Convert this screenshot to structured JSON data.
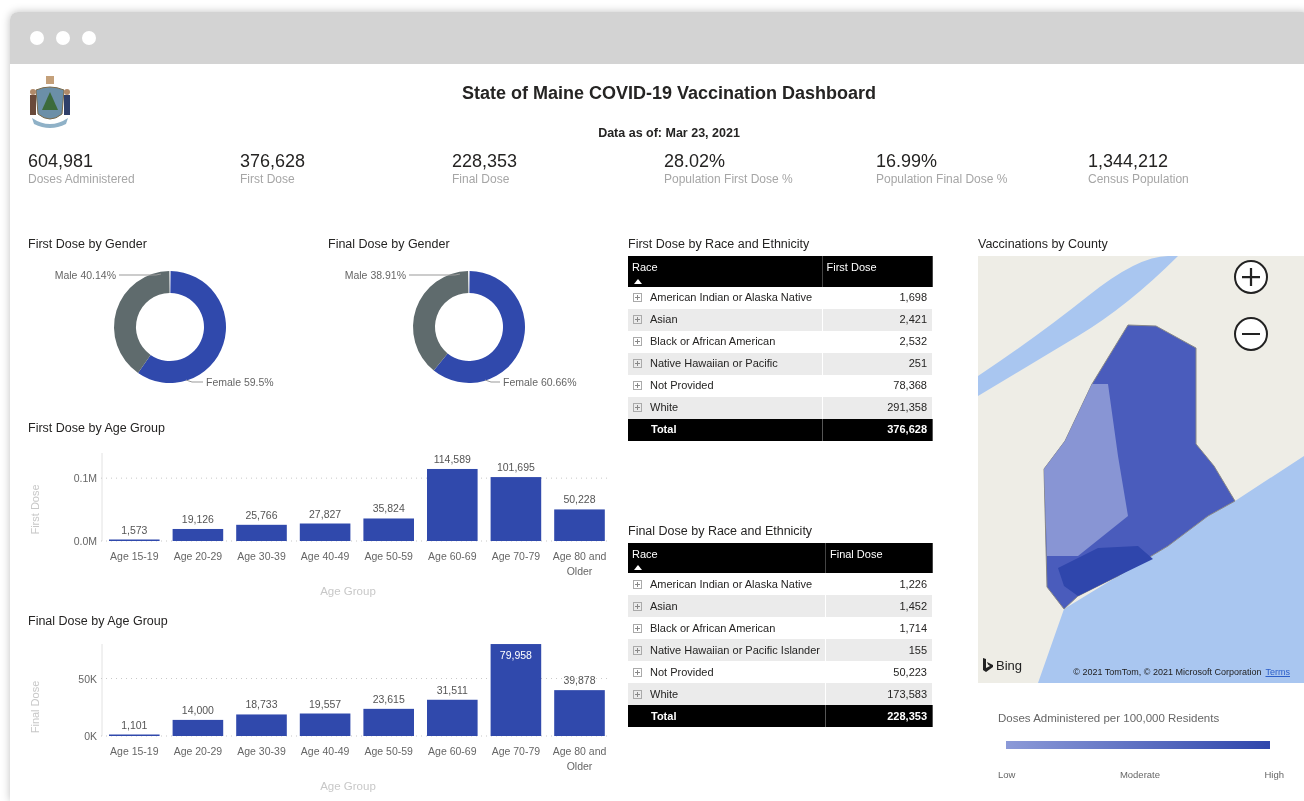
{
  "header": {
    "title": "State of Maine COVID-19 Vaccination Dashboard",
    "subtitle": "Data as of: Mar 23, 2021"
  },
  "kpis": [
    {
      "value": "604,981",
      "label": "Doses Administered"
    },
    {
      "value": "376,628",
      "label": "First Dose"
    },
    {
      "value": "228,353",
      "label": "Final Dose"
    },
    {
      "value": "28.02%",
      "label": "Population First Dose %"
    },
    {
      "value": "16.99%",
      "label": "Population Final Dose %"
    },
    {
      "value": "1,344,212",
      "label": "Census Population"
    }
  ],
  "gender_charts": [
    {
      "title": "First Dose by Gender",
      "chart_data": {
        "type": "donut",
        "categories": [
          "Female",
          "Male"
        ],
        "values": [
          59.5,
          40.14
        ],
        "value_labels": [
          "59.5%",
          "40.14%"
        ]
      }
    },
    {
      "title": "Final Dose by Gender",
      "chart_data": {
        "type": "donut",
        "categories": [
          "Female",
          "Male"
        ],
        "values": [
          60.66,
          38.91
        ],
        "value_labels": [
          "60.66%",
          "38.91%"
        ]
      }
    }
  ],
  "age_charts": [
    {
      "title": "First Dose by Age Group",
      "chart_data": {
        "type": "bar",
        "xlabel": "Age Group",
        "ylabel": "First Dose",
        "categories": [
          "Age 15-19",
          "Age 20-29",
          "Age 30-39",
          "Age 40-49",
          "Age 50-59",
          "Age 60-69",
          "Age 70-79",
          "Age 80 and Older"
        ],
        "values": [
          1573,
          19126,
          25766,
          27827,
          35824,
          114589,
          101695,
          50228
        ],
        "value_labels": [
          "1,573",
          "19,126",
          "25,766",
          "27,827",
          "35,824",
          "114,589",
          "101,695",
          "50,228"
        ],
        "ylim": [
          0,
          140000
        ],
        "yticks": [
          {
            "value": 0,
            "label": "0.0M"
          },
          {
            "value": 100000,
            "label": "0.1M"
          }
        ]
      }
    },
    {
      "title": "Final Dose by Age Group",
      "chart_data": {
        "type": "bar",
        "xlabel": "Age Group",
        "ylabel": "Final Dose",
        "categories": [
          "Age 15-19",
          "Age 20-29",
          "Age 30-39",
          "Age 40-49",
          "Age 50-59",
          "Age 60-69",
          "Age 70-79",
          "Age 80 and Older"
        ],
        "values": [
          1101,
          14000,
          18733,
          19557,
          23615,
          31511,
          79958,
          39878
        ],
        "value_labels": [
          "1,101",
          "14,000",
          "18,733",
          "19,557",
          "23,615",
          "31,511",
          "79,958",
          "39,878"
        ],
        "ylim": [
          0,
          80000
        ],
        "yticks": [
          {
            "value": 0,
            "label": "0K"
          },
          {
            "value": 50000,
            "label": "50K"
          }
        ]
      }
    }
  ],
  "race_tables": [
    {
      "title": "First Dose by Race and Ethnicity",
      "columns": [
        "Race",
        "First Dose"
      ],
      "rows": [
        {
          "race": "American Indian or Alaska Native",
          "value": "1,698"
        },
        {
          "race": "Asian",
          "value": "2,421"
        },
        {
          "race": "Black or African American",
          "value": "2,532"
        },
        {
          "race": "Native Hawaiian or Pacific",
          "value": "251"
        },
        {
          "race": "Not Provided",
          "value": "78,368"
        },
        {
          "race": "White",
          "value": "291,358"
        }
      ],
      "total": {
        "label": "Total",
        "value": "376,628"
      }
    },
    {
      "title": "Final Dose by Race and Ethnicity",
      "columns": [
        "Race",
        "Final Dose"
      ],
      "rows": [
        {
          "race": "American Indian or Alaska Native",
          "value": "1,226"
        },
        {
          "race": "Asian",
          "value": "1,452"
        },
        {
          "race": "Black or African American",
          "value": "1,714"
        },
        {
          "race": "Native Hawaiian or Pacific Islander",
          "value": "155"
        },
        {
          "race": "Not Provided",
          "value": "50,223"
        },
        {
          "race": "White",
          "value": "173,583"
        }
      ],
      "total": {
        "label": "Total",
        "value": "228,353"
      }
    }
  ],
  "map": {
    "title": "Vaccinations by County",
    "provider": "Bing",
    "attribution": "© 2021 TomTom, © 2021 Microsoft Corporation",
    "terms": "Terms",
    "legend": {
      "title": "Doses Administered per 100,000 Residents",
      "low": "Low",
      "mid": "Moderate",
      "high": "High"
    }
  }
}
